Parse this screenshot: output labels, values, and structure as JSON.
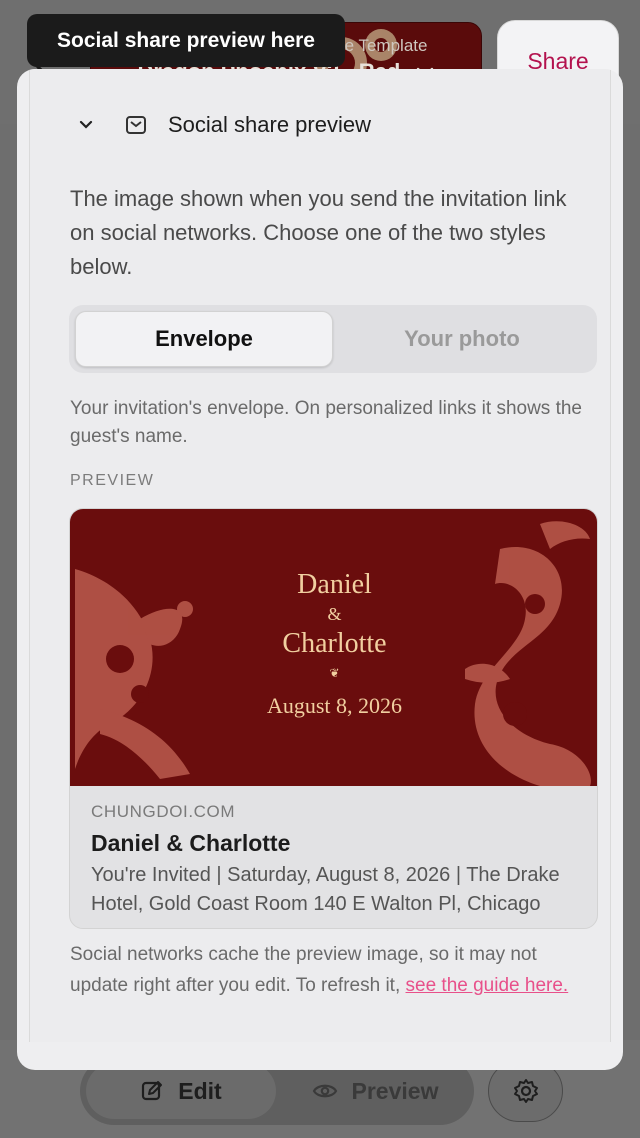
{
  "tooltip": {
    "text": "Social share preview here"
  },
  "header": {
    "template_subtitle": "Change Template",
    "template_name": "Dragon Phoenix V2 - Red",
    "share_label": "Share"
  },
  "section": {
    "title": "Social share preview",
    "description": "The image shown when you send the invitation link on social networks. Choose one of the two styles below.",
    "options": [
      "Envelope",
      "Your photo"
    ],
    "selected_option": "Envelope",
    "hint": "Your invitation's envelope. On personalized links it shows the guest's name.",
    "preview_label": "PREVIEW"
  },
  "card": {
    "name1": "Daniel",
    "ampersand": "&",
    "name2": "Charlotte",
    "flourish": "❦",
    "date": "August 8, 2026",
    "domain": "CHUNGDOI.COM",
    "title": "Daniel & Charlotte",
    "description": "You're Invited | Saturday, August 8, 2026 | The Drake Hotel, Gold Coast Room 140 E Walton Pl, Chicago"
  },
  "footnote": {
    "text": "Social networks cache the preview image, so it may not update right after you edit. To refresh it,",
    "link_text": "see the guide here."
  },
  "bottom_bar": {
    "edit_label": "Edit",
    "preview_label": "Preview"
  },
  "colors": {
    "accent_pink": "#e8508a",
    "share_text": "#b3124e",
    "card_red": "#6a0d0d",
    "gold": "#f1cfa0"
  }
}
